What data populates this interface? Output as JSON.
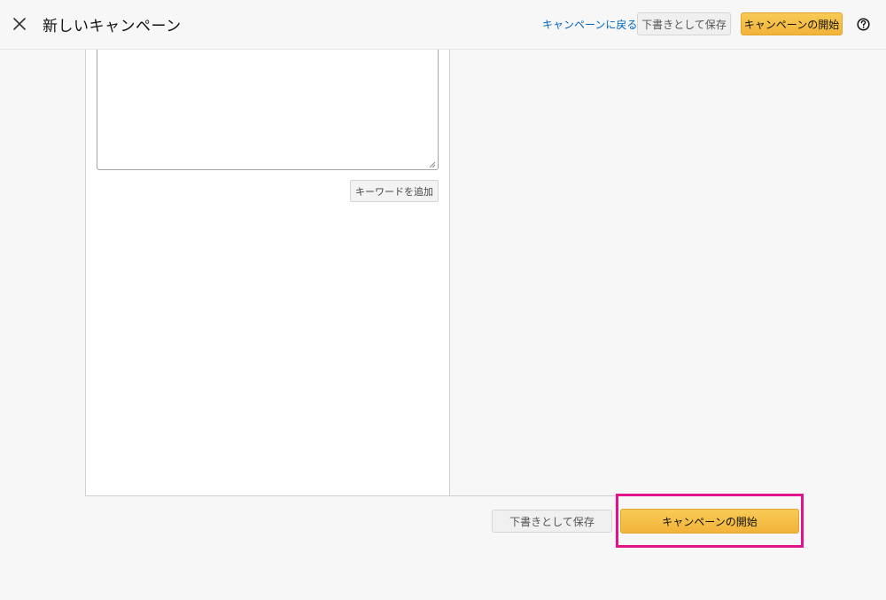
{
  "header": {
    "title": "新しいキャンペーン",
    "back_link": "キャンペーンに戻る",
    "save_draft_label": "下書きとして保存",
    "launch_label": "キャンペーンの開始"
  },
  "editor": {
    "keyword_text": "",
    "add_keyword_label": "キーワードを追加"
  },
  "footer": {
    "save_draft_label": "下書きとして保存",
    "launch_label": "キャンペーンの開始"
  },
  "colors": {
    "accent": "#f0c14b",
    "link": "#0066c0",
    "highlight": "#e0138c"
  },
  "icons": {
    "close": "close-icon",
    "help": "help-circle-icon"
  }
}
